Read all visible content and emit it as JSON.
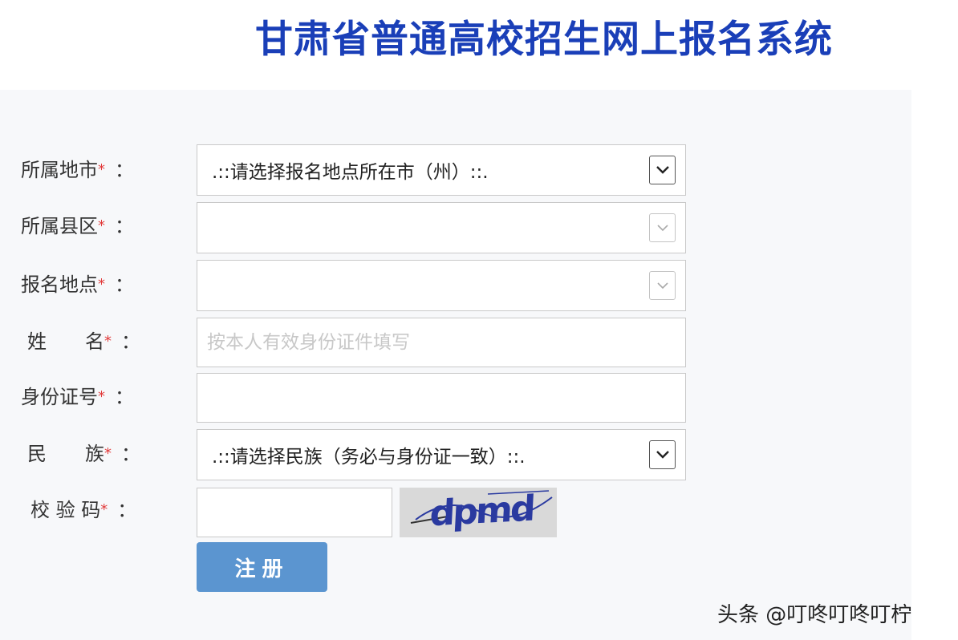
{
  "header": {
    "title": "甘肃省普通高校招生网上报名系统"
  },
  "form": {
    "city": {
      "label": "所属地市",
      "selected": ".::请选择报名地点所在市（州）::."
    },
    "county": {
      "label": "所属县区",
      "selected": ""
    },
    "location": {
      "label": "报名地点",
      "selected": ""
    },
    "name": {
      "label": "姓　　名",
      "placeholder": "按本人有效身份证件填写",
      "value": ""
    },
    "id_number": {
      "label": "身份证号",
      "value": ""
    },
    "ethnicity": {
      "label": "民　　族",
      "selected": ".::请选择民族（务必与身份证一致）::."
    },
    "captcha": {
      "label": "校 验 码",
      "value": "",
      "image_text": "dpmd"
    },
    "required_mark": "*",
    "colon": "：",
    "submit_label": "注册"
  },
  "watermark": {
    "text": "头条 @叮咚叮咚叮柠"
  },
  "colors": {
    "title": "#1a3fb8",
    "required": "#e23b3b",
    "button": "#5b95d0"
  }
}
